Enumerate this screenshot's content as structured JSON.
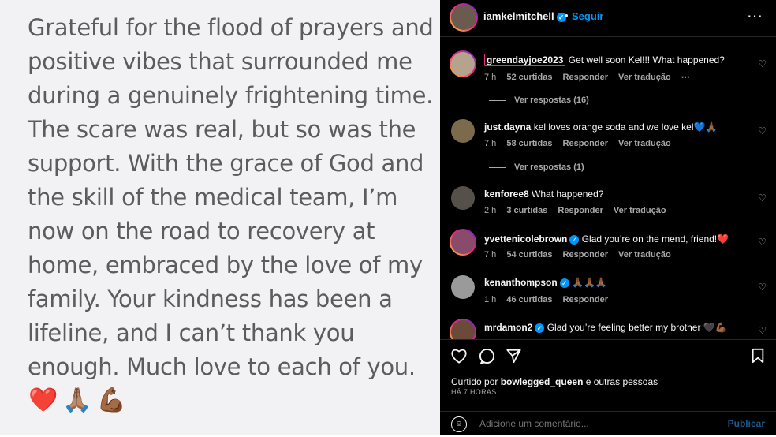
{
  "post": {
    "text": "Grateful for the flood of prayers and positive vibes that surrounded me during a genuinely frightening time. The scare was real, but so was the support. With the grace of God and the skill of the medical team, I’m now on the road to recovery at home, embraced by the love of my family. Your kindness has been a lifeline, and I can’t thank you enough. Much love to each of you.",
    "emojis": [
      "❤️",
      "🙏🏽",
      "💪🏾"
    ]
  },
  "header": {
    "username": "iamkelmitchell",
    "separator": "•",
    "follow_label": "Seguir",
    "more": "⋯"
  },
  "comments": [
    {
      "user": "greendayjoe2023",
      "text": "Get well soon Kel!!! What happened?",
      "time": "7 h",
      "likes": "52 curtidas",
      "reply": "Responder",
      "translate": "Ver tradução",
      "dots": "⋯",
      "replies": "Ver respostas (16)",
      "verified": false
    },
    {
      "user": "just.dayna",
      "text": "kel loves orange soda and we love kel💙🙏🏾",
      "time": "7 h",
      "likes": "58 curtidas",
      "reply": "Responder",
      "translate": "Ver tradução",
      "replies": "Ver respostas (1)",
      "verified": false
    },
    {
      "user": "kenforee8",
      "text": "What happened?",
      "time": "2 h",
      "likes": "3 curtidas",
      "reply": "Responder",
      "translate": "Ver tradução",
      "verified": false
    },
    {
      "user": "yvettenicolebrown",
      "text": "Glad you’re on the mend, friend!❤️",
      "time": "7 h",
      "likes": "54 curtidas",
      "reply": "Responder",
      "translate": "Ver tradução",
      "verified": true
    },
    {
      "user": "kenanthompson",
      "text": "🙏🏾🙏🏾🙏🏾",
      "time": "1 h",
      "likes": "46 curtidas",
      "reply": "Responder",
      "verified": true
    },
    {
      "user": "mrdamon2",
      "text": "Glad you’re feeling better my brother 🖤💪🏾",
      "verified": true
    }
  ],
  "footer": {
    "liked_prefix": "Curtido por",
    "liked_user": "bowlegged_queen",
    "liked_suffix": "e outras pessoas",
    "time_ago": "HÁ 7 HORAS",
    "comment_placeholder": "Adicione um comentário...",
    "publish_label": "Publicar"
  },
  "colors": {
    "accent": "#0095f6",
    "background_left": "#f2f2f4",
    "background_right": "#000000",
    "text_secondary": "#a8a8a8"
  }
}
